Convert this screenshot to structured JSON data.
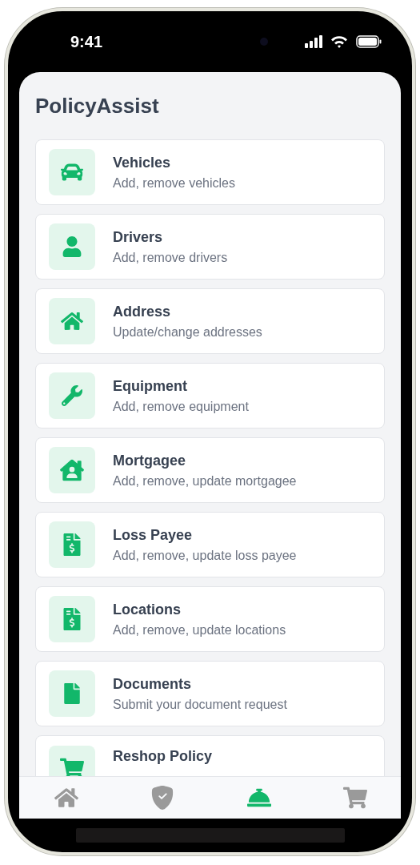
{
  "status_bar": {
    "time": "9:41"
  },
  "title": "PolicyAssist",
  "items": [
    {
      "title": "Vehicles",
      "subtitle": "Add, remove vehicles"
    },
    {
      "title": "Drivers",
      "subtitle": "Add, remove drivers"
    },
    {
      "title": "Address",
      "subtitle": "Update/change addresses"
    },
    {
      "title": "Equipment",
      "subtitle": "Add, remove equipment"
    },
    {
      "title": "Mortgagee",
      "subtitle": "Add, remove, update mortgagee"
    },
    {
      "title": "Loss Payee",
      "subtitle": "Add, remove, update loss payee"
    },
    {
      "title": "Locations",
      "subtitle": "Add, remove, update locations"
    },
    {
      "title": "Documents",
      "subtitle": "Submit your document request"
    },
    {
      "title": "Reshop Policy"
    }
  ],
  "nav": [
    {
      "selected": false
    },
    {
      "selected": false
    },
    {
      "selected": true
    },
    {
      "selected": false
    }
  ]
}
